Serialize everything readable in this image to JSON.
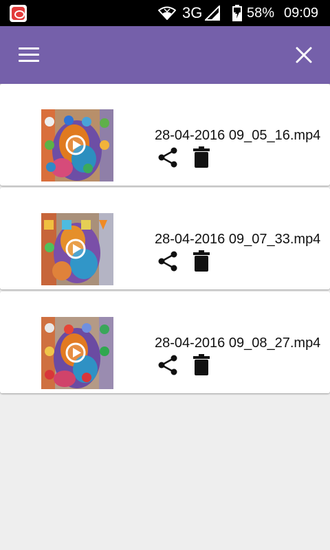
{
  "status_bar": {
    "network": "3G",
    "battery": "58%",
    "time": "09:09",
    "icons": [
      "app-notification-icon",
      "wifi-icon",
      "signal-icon",
      "battery-charging-icon"
    ]
  },
  "toolbar": {
    "color": "#7560aa",
    "left_icon": "menu-icon",
    "right_icon": "close-icon"
  },
  "videos": [
    {
      "file_name": "28-04-2016 09_05_16.mp4"
    },
    {
      "file_name": "28-04-2016 09_07_33.mp4"
    },
    {
      "file_name": "28-04-2016 09_08_27.mp4"
    }
  ]
}
